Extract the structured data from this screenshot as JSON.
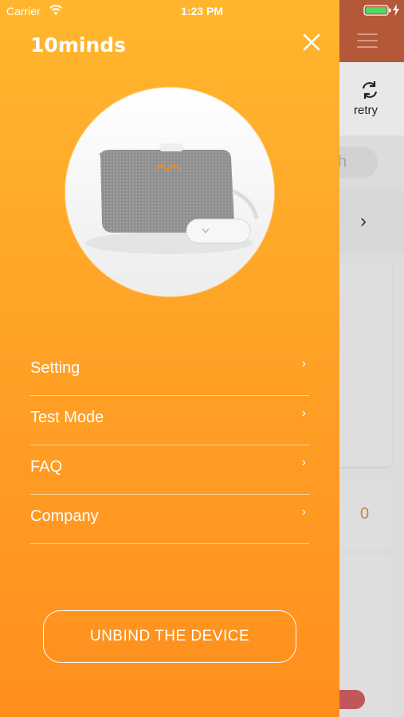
{
  "status_bar": {
    "carrier": "Carrier",
    "time": "1:23 PM"
  },
  "brand": {
    "logo_text": "10minds"
  },
  "drawer": {
    "menu": [
      {
        "label": "Setting"
      },
      {
        "label": "Test Mode"
      },
      {
        "label": "FAQ"
      },
      {
        "label": "Company"
      }
    ],
    "unbind_label": "UNBIND THE DEVICE",
    "chevron_glyph": "›"
  },
  "background": {
    "retry_label": "retry",
    "search_partial": "h",
    "row_chevron": "›",
    "value_zero": "0"
  },
  "colors": {
    "drawer_top": "#ffb62e",
    "drawer_bottom": "#ff8f1d",
    "header_bg": "#b4583a"
  },
  "icons": [
    "wifi-icon",
    "battery-icon",
    "close-icon",
    "menu-icon",
    "retry-icon",
    "chevron-right-icon"
  ]
}
